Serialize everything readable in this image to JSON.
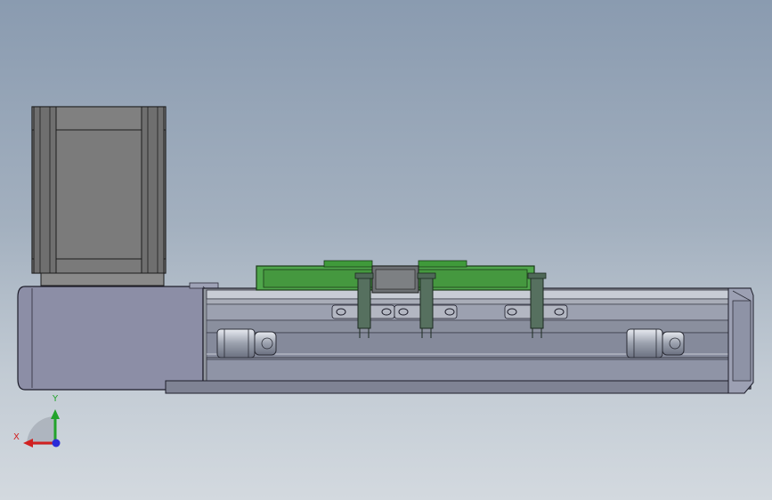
{
  "viewport": {
    "background_top": "#8a9bb0",
    "background_bottom": "#d3d9df"
  },
  "model": {
    "motor_color": "#7b7b7b",
    "rail_color": "#8f95ad",
    "carriage_color": "#4fa64b",
    "bracket_color": "#56705f"
  },
  "triad": {
    "x_label": "X",
    "y_label": "Y",
    "x_color": "#d12020",
    "y_color": "#22a32b",
    "z_color": "#2a2ad8"
  }
}
